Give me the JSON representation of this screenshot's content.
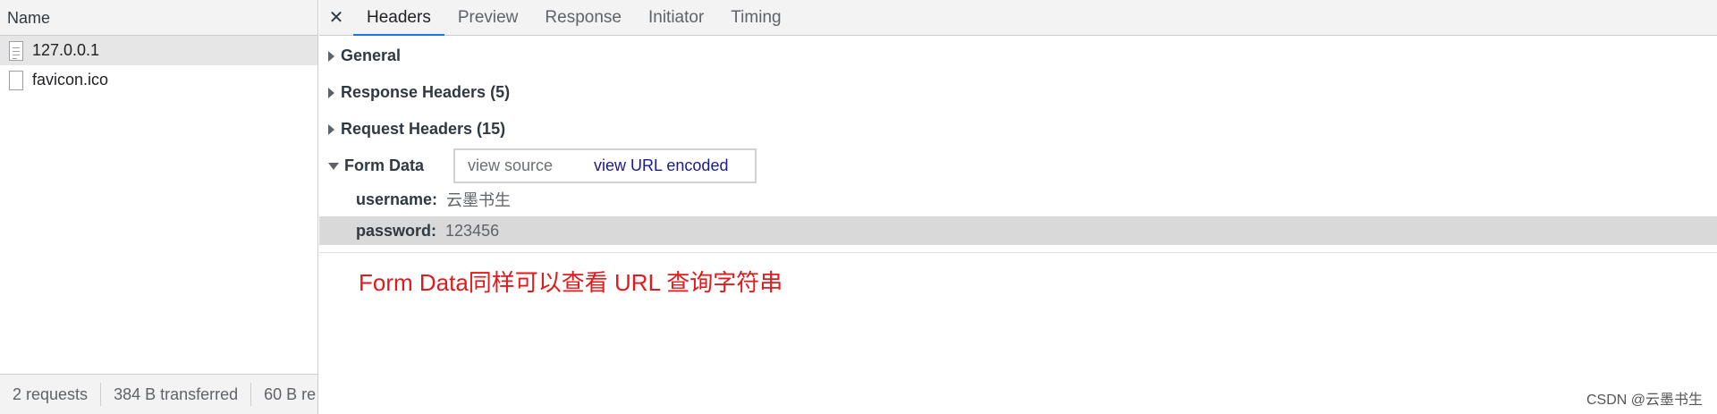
{
  "left": {
    "header": "Name",
    "requests": [
      {
        "name": "127.0.0.1",
        "icon": "document-icon"
      },
      {
        "name": "favicon.ico",
        "icon": "file-icon"
      }
    ],
    "footer": {
      "requests": "2 requests",
      "transferred": "384 B transferred",
      "resources": "60 B re"
    }
  },
  "tabs": {
    "close": "✕",
    "items": [
      "Headers",
      "Preview",
      "Response",
      "Initiator",
      "Timing"
    ],
    "active": "Headers"
  },
  "sections": {
    "general": "General",
    "response_headers": "Response Headers (5)",
    "request_headers": "Request Headers (15)",
    "form_data": "Form Data"
  },
  "form_data": {
    "view_source": "view source",
    "view_url_encoded": "view URL encoded",
    "fields": [
      {
        "key": "username:",
        "value": "云墨书生"
      },
      {
        "key": "password:",
        "value": "123456"
      }
    ]
  },
  "annotation": "Form Data同样可以查看 URL 查询字符串",
  "watermark": "CSDN @云墨书生",
  "colors": {
    "accent": "#1a73e8",
    "annotation": "#e31a1c",
    "highlight_row": "#d9d9d9"
  }
}
